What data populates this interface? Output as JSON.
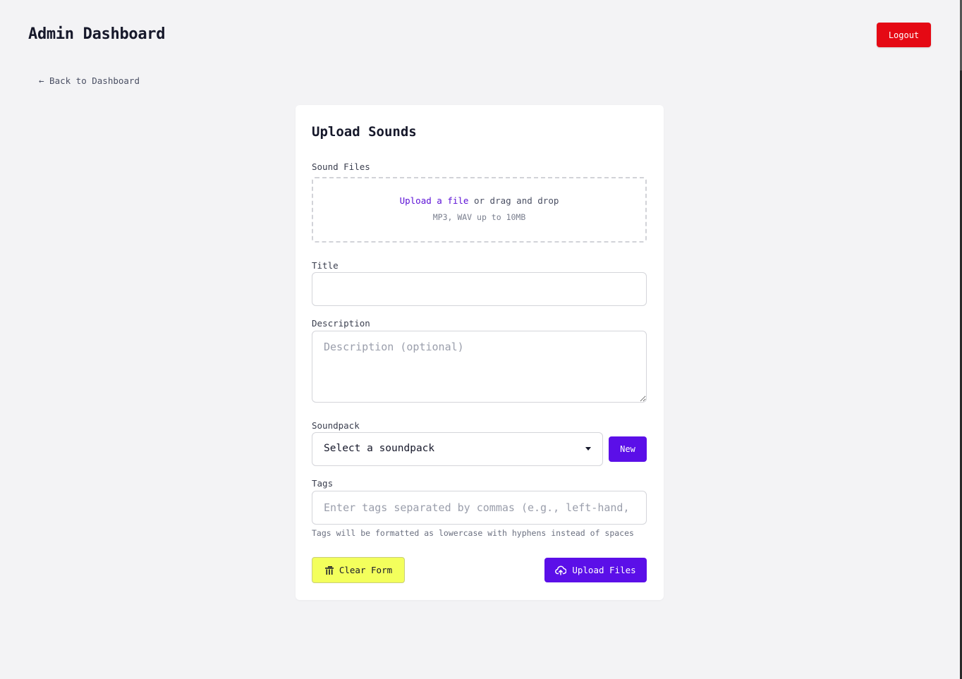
{
  "header": {
    "title": "Admin Dashboard",
    "logout_label": "Logout"
  },
  "nav": {
    "back_label": "← Back to Dashboard"
  },
  "form": {
    "title": "Upload Sounds",
    "sound_files": {
      "label": "Sound Files",
      "upload_link": "Upload a file",
      "drag_text": " or drag and drop",
      "formats": "MP3, WAV up to 10MB"
    },
    "title_field": {
      "label": "Title",
      "value": "",
      "placeholder": ""
    },
    "description_field": {
      "label": "Description",
      "value": "",
      "placeholder": "Description (optional)"
    },
    "soundpack_field": {
      "label": "Soundpack",
      "selected": "Select a soundpack",
      "new_label": "New"
    },
    "tags_field": {
      "label": "Tags",
      "value": "",
      "placeholder": "Enter tags separated by commas (e.g., left-hand, drums)",
      "hint": "Tags will be formatted as lowercase with hyphens instead of spaces"
    },
    "clear_label": "Clear Form",
    "upload_label": "Upload Files"
  },
  "colors": {
    "accent": "#5b0fe8",
    "danger": "#e50914",
    "clear_button": "#f3ff5c",
    "background": "#f3f3f5"
  },
  "icons": {
    "clear": "trash-icon",
    "upload": "cloud-upload-icon"
  }
}
